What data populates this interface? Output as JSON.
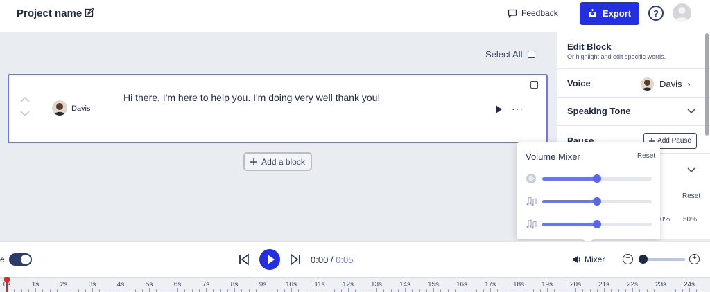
{
  "header": {
    "project_name": "Project name",
    "feedback_label": "Feedback",
    "export_label": "Export",
    "help_symbol": "?"
  },
  "main": {
    "select_all_label": "Select All",
    "block": {
      "speaker_name": "Davis",
      "text": "Hi there, I'm here to help you. I'm doing very well thank you!",
      "more_symbol": "···"
    },
    "add_block_label": "Add a block"
  },
  "panel": {
    "title": "Edit Block",
    "subtitle": "Or highlight and edit specific words.",
    "voice_label": "Voice",
    "voice_value": "Davis",
    "tone_label": "Speaking Tone",
    "pause_label": "Pause",
    "add_pause_label": "Add Pause",
    "reset_label": "Reset",
    "pct_a": "0%",
    "pct_b": "50%"
  },
  "mixer_popup": {
    "title": "Volume Mixer",
    "reset_label": "Reset",
    "channels": [
      {
        "icon": "voice-icon",
        "level": 0.5
      },
      {
        "icon": "music-note-icon",
        "level": 0.5
      },
      {
        "icon": "music-note-icon",
        "level": 0.5
      }
    ]
  },
  "player": {
    "toggle_label": "e",
    "current_time": "0:00",
    "separator": " / ",
    "duration": "0:05",
    "mixer_label": "Mixer"
  },
  "timeline": {
    "labels": [
      "0s",
      "1s",
      "2s",
      "3s",
      "4s",
      "5s",
      "6s",
      "7s",
      "8s",
      "9s",
      "10s",
      "11s",
      "12s",
      "13s",
      "14s",
      "15s",
      "16s",
      "17s",
      "18s",
      "19s",
      "20s",
      "21s",
      "22s",
      "23s",
      "24s"
    ]
  },
  "colors": {
    "accent": "#2430e0",
    "slider": "#6b78e8",
    "playhead": "#e02424"
  }
}
